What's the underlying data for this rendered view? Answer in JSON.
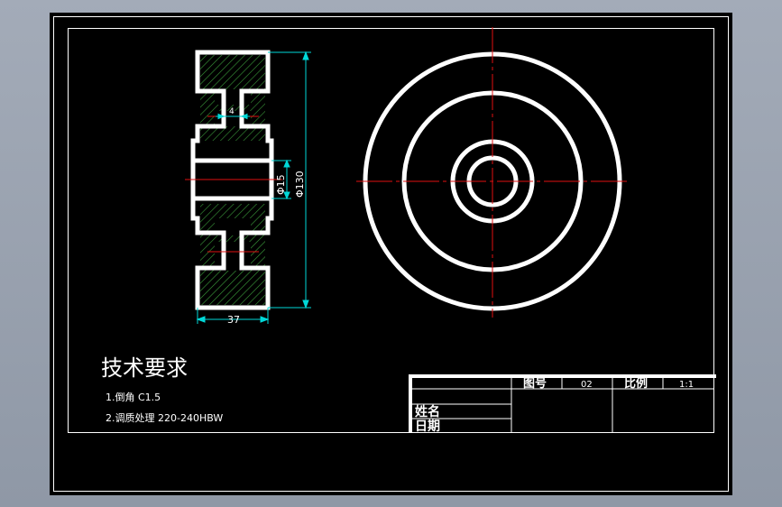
{
  "colors": {
    "background": "#000000",
    "lines": "#ffffff",
    "centerline": "#e01010",
    "dimension": "#00d8d8",
    "hatch": "#3a9a3a"
  },
  "tech_requirements": {
    "title": "技术要求",
    "item1": "1.倒角 C1.5",
    "item2": "2.调质处理  220-240HBW"
  },
  "dimensions": {
    "width": "37",
    "outer_diameter": "Φ130",
    "bore_diameter": "Φ15",
    "groove": "4"
  },
  "title_block": {
    "drawing_no_label": "图号",
    "drawing_no_value": "02",
    "scale_label": "比例",
    "scale_value": "1:1",
    "name_label": "姓名",
    "date_label": "日期"
  }
}
